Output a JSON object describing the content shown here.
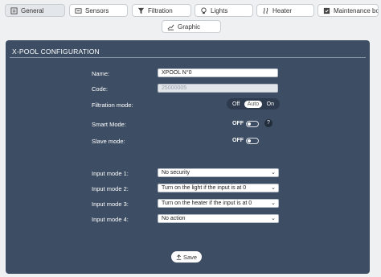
{
  "tabs": [
    {
      "label": "General",
      "icon": "sliders-icon"
    },
    {
      "label": "Sensors",
      "icon": "sensor-icon"
    },
    {
      "label": "Filtration",
      "icon": "filter-icon"
    },
    {
      "label": "Lights",
      "icon": "bulb-icon"
    },
    {
      "label": "Heater",
      "icon": "heater-icon"
    },
    {
      "label": "Maintenance book",
      "icon": "book-icon"
    },
    {
      "label": "Graphic",
      "icon": "chart-icon"
    }
  ],
  "panel": {
    "title": "X-POOL CONFIGURATION"
  },
  "form": {
    "name_label": "Name:",
    "name_value": "XPOOL N°0",
    "code_label": "Code:",
    "code_value": "25000005",
    "filtration_label": "Filtration mode:",
    "filtration_options": [
      "Off",
      "Auto",
      "On"
    ],
    "filtration_selected": "Auto",
    "smart_label": "Smart Mode:",
    "smart_state": "OFF",
    "slave_label": "Slave mode:",
    "slave_state": "OFF",
    "help_symbol": "?"
  },
  "inputs": [
    {
      "label": "Input mode 1:",
      "value": "No security"
    },
    {
      "label": "Input mode 2:",
      "value": "Turn on the light if the input is at 0"
    },
    {
      "label": "Input mode 3:",
      "value": "Turn on the heater if the input is at 0"
    },
    {
      "label": "Input mode 4:",
      "value": "No action"
    }
  ],
  "save_label": "Save",
  "colors": {
    "panel": "#3d4d63",
    "page": "#eef0f2"
  }
}
